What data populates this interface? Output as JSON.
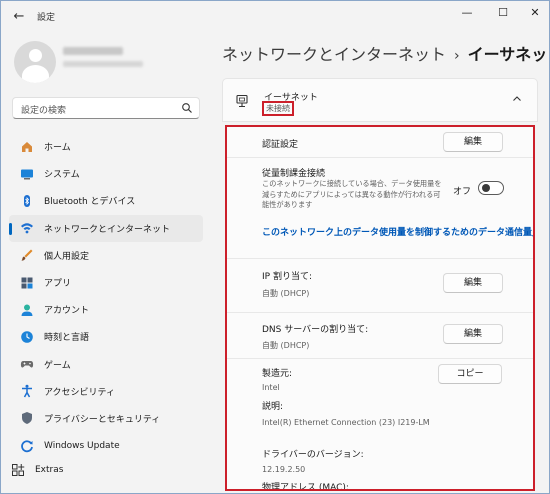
{
  "window": {
    "title": "設定",
    "back_glyph": "←",
    "minimize_glyph": "—",
    "maximize_glyph": "☐",
    "close_glyph": "✕"
  },
  "search": {
    "placeholder": "設定の検索"
  },
  "sidebar": {
    "items": [
      {
        "label": "ホーム",
        "icon": "home-icon"
      },
      {
        "label": "システム",
        "icon": "system-icon"
      },
      {
        "label": "Bluetooth とデバイス",
        "icon": "bluetooth-icon"
      },
      {
        "label": "ネットワークとインターネット",
        "icon": "network-icon",
        "active": true
      },
      {
        "label": "個人用設定",
        "icon": "personalization-icon"
      },
      {
        "label": "アプリ",
        "icon": "apps-icon"
      },
      {
        "label": "アカウント",
        "icon": "accounts-icon"
      },
      {
        "label": "時刻と言語",
        "icon": "time-language-icon"
      },
      {
        "label": "ゲーム",
        "icon": "gaming-icon"
      },
      {
        "label": "アクセシビリティ",
        "icon": "accessibility-icon"
      },
      {
        "label": "プライバシーとセキュリティ",
        "icon": "privacy-icon"
      },
      {
        "label": "Windows Update",
        "icon": "windows-update-icon"
      }
    ],
    "extras": "Extras"
  },
  "header": {
    "parent": "ネットワークとインターネット",
    "separator": "›",
    "current": "イーサネット"
  },
  "card": {
    "title": "イーサネット",
    "status": "未接続"
  },
  "details": {
    "auth": {
      "label": "認証設定",
      "button": "編集"
    },
    "metered": {
      "label": "従量制課金接続",
      "description": "このネットワークに接続している場合、データ使用量を減らすためにアプリによっては異なる動作が行われる可能性があります",
      "toggle_label": "オフ",
      "toggle_on": false
    },
    "data_limit_link": "このネットワーク上のデータ使用量を制御するためのデータ通信量」",
    "ip": {
      "label": "IP 割り当て:",
      "value": "自動 (DHCP)",
      "button": "編集"
    },
    "dns": {
      "label": "DNS サーバーの割り当て:",
      "value": "自動 (DHCP)",
      "button": "編集"
    },
    "properties": {
      "copy_button": "コピー",
      "manufacturer_label": "製造元:",
      "manufacturer": "Intel",
      "description_label": "説明:",
      "description": "Intel(R) Ethernet Connection (23) I219-LM",
      "driver_label": "ドライバーのバージョン:",
      "driver": "12.19.2.50",
      "mac_label": "物理アドレス (MAC):"
    }
  },
  "colors": {
    "accent": "#0067c0",
    "highlight_border": "#cc1f2a",
    "link": "#0058b7"
  }
}
